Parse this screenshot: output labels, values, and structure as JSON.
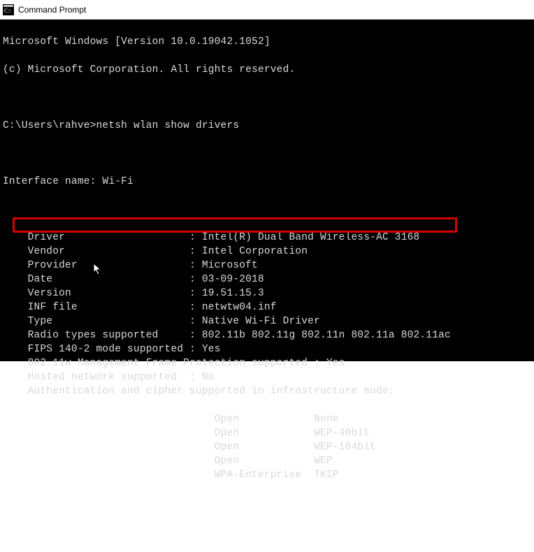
{
  "window": {
    "title": "Command Prompt"
  },
  "header": {
    "line1": "Microsoft Windows [Version 10.0.19042.1052]",
    "line2": "(c) Microsoft Corporation. All rights reserved."
  },
  "prompt": {
    "path": "C:\\Users\\rahve>",
    "command": "netsh wlan show drivers"
  },
  "interface_line": "Interface name: Wi-Fi",
  "props": [
    {
      "label": "Driver",
      "value": "Intel(R) Dual Band Wireless-AC 3168"
    },
    {
      "label": "Vendor",
      "value": "Intel Corporation"
    },
    {
      "label": "Provider",
      "value": "Microsoft"
    },
    {
      "label": "Date",
      "value": "03-09-2018"
    },
    {
      "label": "Version",
      "value": "19.51.15.3"
    },
    {
      "label": "INF file",
      "value": "netwtw04.inf"
    },
    {
      "label": "Type",
      "value": "Native Wi-Fi Driver"
    },
    {
      "label": "Radio types supported",
      "value": "802.11b 802.11g 802.11n 802.11a 802.11ac"
    },
    {
      "label": "FIPS 140-2 mode supported",
      "value": "Yes"
    },
    {
      "label": "802.11w Management Frame Protection supported",
      "value": "Yes"
    },
    {
      "label": "Hosted network supported",
      "value": "No"
    },
    {
      "label": "Authentication and cipher supported in infrastructure mode:",
      "value": ""
    }
  ],
  "auth_rows": [
    {
      "auth": "Open",
      "cipher": "None"
    },
    {
      "auth": "Open",
      "cipher": "WEP-40bit"
    },
    {
      "auth": "Open",
      "cipher": "WEP-104bit"
    },
    {
      "auth": "Open",
      "cipher": "WEP"
    },
    {
      "auth": "WPA-Enterprise",
      "cipher": "TKIP"
    }
  ]
}
